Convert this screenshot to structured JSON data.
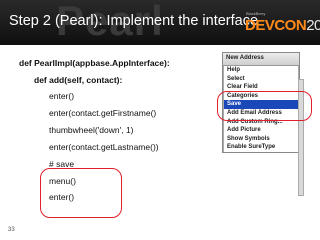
{
  "header": {
    "title": "Step 2 (Pearl): Implement the interface",
    "watermark": "Pearl",
    "brand": {
      "blackberry": "BlackBerry",
      "devcon": "DEVCON",
      "year": "2010"
    }
  },
  "code": {
    "lines": [
      "def PearlImpl(appbase.AppInterface):",
      "def add(self, contact):",
      "enter()",
      "enter(contact.getFirstname()",
      "thumbwheel('down', 1)",
      "enter(contact.getLastname())",
      "# save",
      "menu()",
      "enter()"
    ]
  },
  "menu": {
    "title": "New Address",
    "items": [
      "Help",
      "Select",
      "Clear Field",
      "Categories",
      "Save",
      "Add Email Address",
      "Add Custom Ring...",
      "Add Picture",
      "Show Symbols",
      "Enable SureType"
    ],
    "selected_index": 4
  },
  "colors": {
    "header_bg": "#111111",
    "devcon_orange": "#ff8a1a",
    "highlight_red": "#e0202a",
    "menu_selected": "#1a48b8"
  },
  "footer": {
    "page_number": "33"
  }
}
